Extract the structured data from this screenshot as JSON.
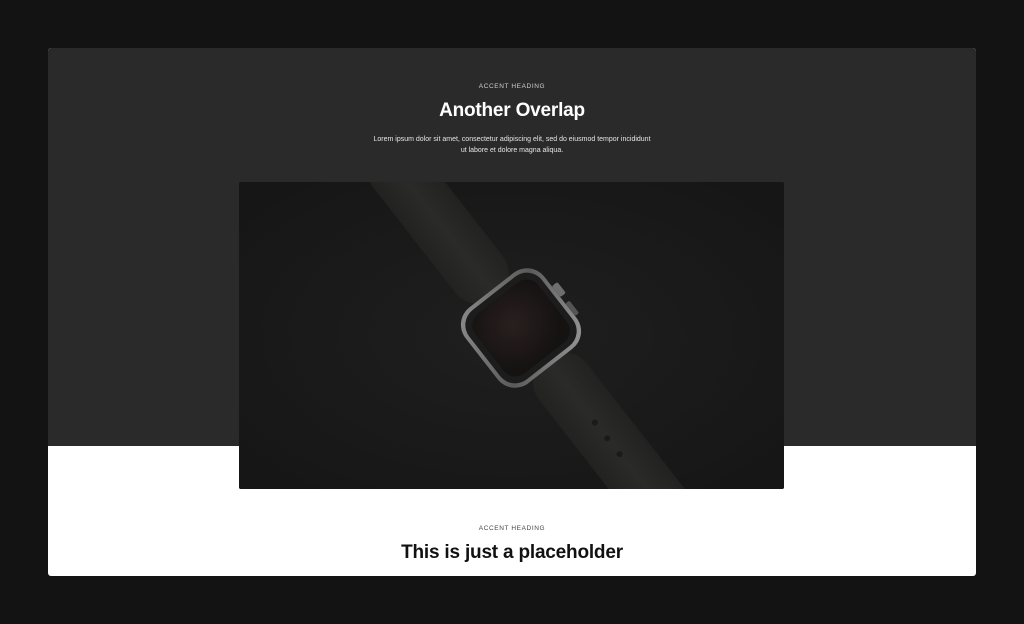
{
  "hero": {
    "accent_heading": "ACCENT HEADING",
    "title": "Another Overlap",
    "body": "Lorem ipsum dolor sit amet, consectetur adipiscing elit, sed do eiusmod tempor incididunt ut labore et dolore magna aliqua."
  },
  "media": {
    "icon": "watch-image"
  },
  "section": {
    "accent_heading": "ACCENT HEADING",
    "title": "This is just a placeholder"
  },
  "colors": {
    "page_bg": "#131314",
    "hero_bg": "#2a2a2b",
    "section_bg": "#ffffff",
    "media_bg": "#1b1b1b"
  }
}
